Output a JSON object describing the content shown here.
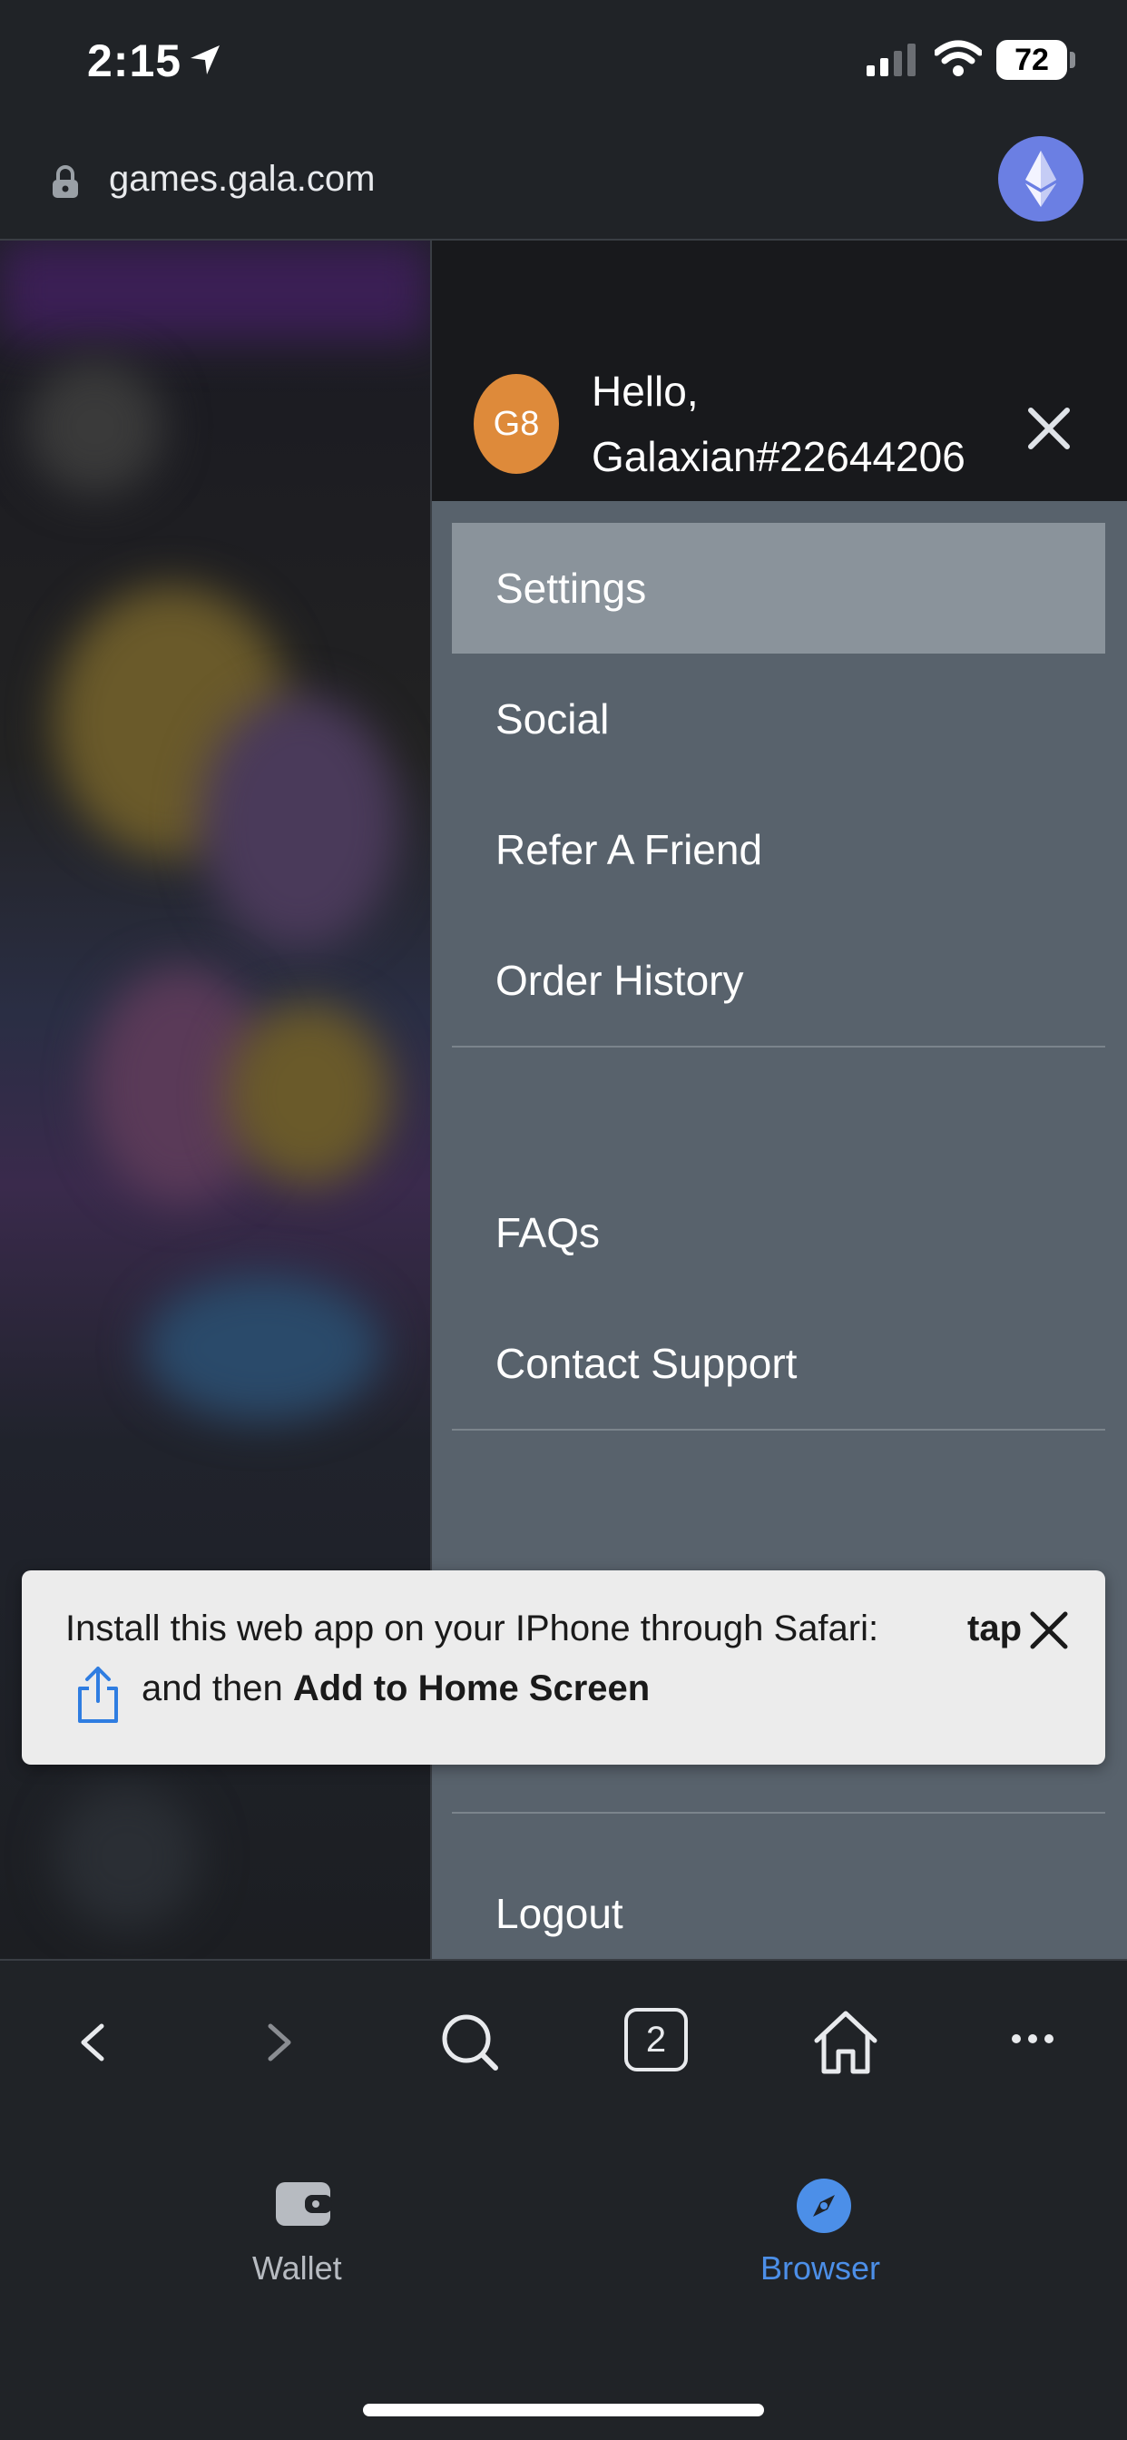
{
  "status_bar": {
    "time": "2:15",
    "battery": "72"
  },
  "browser": {
    "url": "games.gala.com",
    "tabs_count": "2"
  },
  "menu": {
    "greeting_line1": "Hello,",
    "greeting_line2": "Galaxian#22644206",
    "avatar_initials": "G8",
    "selected_item": "Settings",
    "items": [
      {
        "label": "Settings"
      },
      {
        "label": "Social"
      },
      {
        "label": "Refer A Friend"
      },
      {
        "label": "Order History"
      },
      {
        "label": "FAQs"
      },
      {
        "label": "Contact Support"
      },
      {
        "label": "Logout"
      }
    ]
  },
  "toast": {
    "line1": "Install this web app on your IPhone through Safari:",
    "tap": "tap",
    "line2_prefix": "and then",
    "line2_bold": "Add to Home Screen"
  },
  "tab_bar": {
    "wallet": "Wallet",
    "browser": "Browser",
    "active": "Browser"
  },
  "colors": {
    "menu_bg": "#58626c",
    "menu_selected": "#8a939b",
    "avatar": "#de8a3a",
    "accent": "#4c8fe8",
    "eth": "#6b7fe3"
  },
  "icons": {
    "location": "location-arrow-icon",
    "signal": "cellular-signal-icon",
    "wifi": "wifi-icon",
    "lock": "lock-icon",
    "eth": "ethereum-icon",
    "close": "close-icon",
    "share": "share-icon",
    "back": "chevron-left-icon",
    "forward": "chevron-right-icon",
    "search": "search-icon",
    "home": "home-icon",
    "more": "more-icon",
    "wallet": "wallet-icon",
    "browser": "compass-icon"
  }
}
